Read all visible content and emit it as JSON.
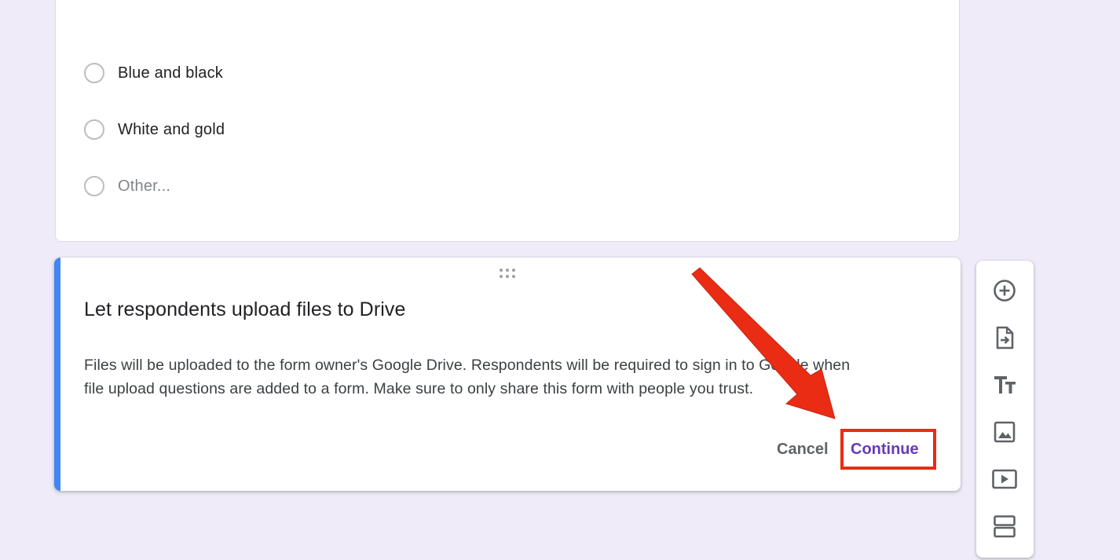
{
  "question": {
    "options": [
      {
        "label": "Blue and black"
      },
      {
        "label": "White and gold"
      },
      {
        "label": "Other..."
      }
    ]
  },
  "dialog": {
    "title": "Let respondents upload files to Drive",
    "body_line1": "Files will be uploaded to the form owner's Google Drive. Respondents will be required to sign in to Google when",
    "body_line2": "file upload questions are added to a form. Make sure to only share this form with people you trust.",
    "cancel_label": "Cancel",
    "continue_label": "Continue"
  },
  "toolbar": {
    "items": [
      {
        "icon": "add-circle-icon"
      },
      {
        "icon": "import-questions-icon"
      },
      {
        "icon": "title-text-icon"
      },
      {
        "icon": "image-icon"
      },
      {
        "icon": "video-icon"
      },
      {
        "icon": "section-icon"
      }
    ]
  },
  "colors": {
    "background": "#efebf9",
    "accent": "#4285f4",
    "primary": "#673ab7",
    "annotation": "#ea2c14"
  }
}
